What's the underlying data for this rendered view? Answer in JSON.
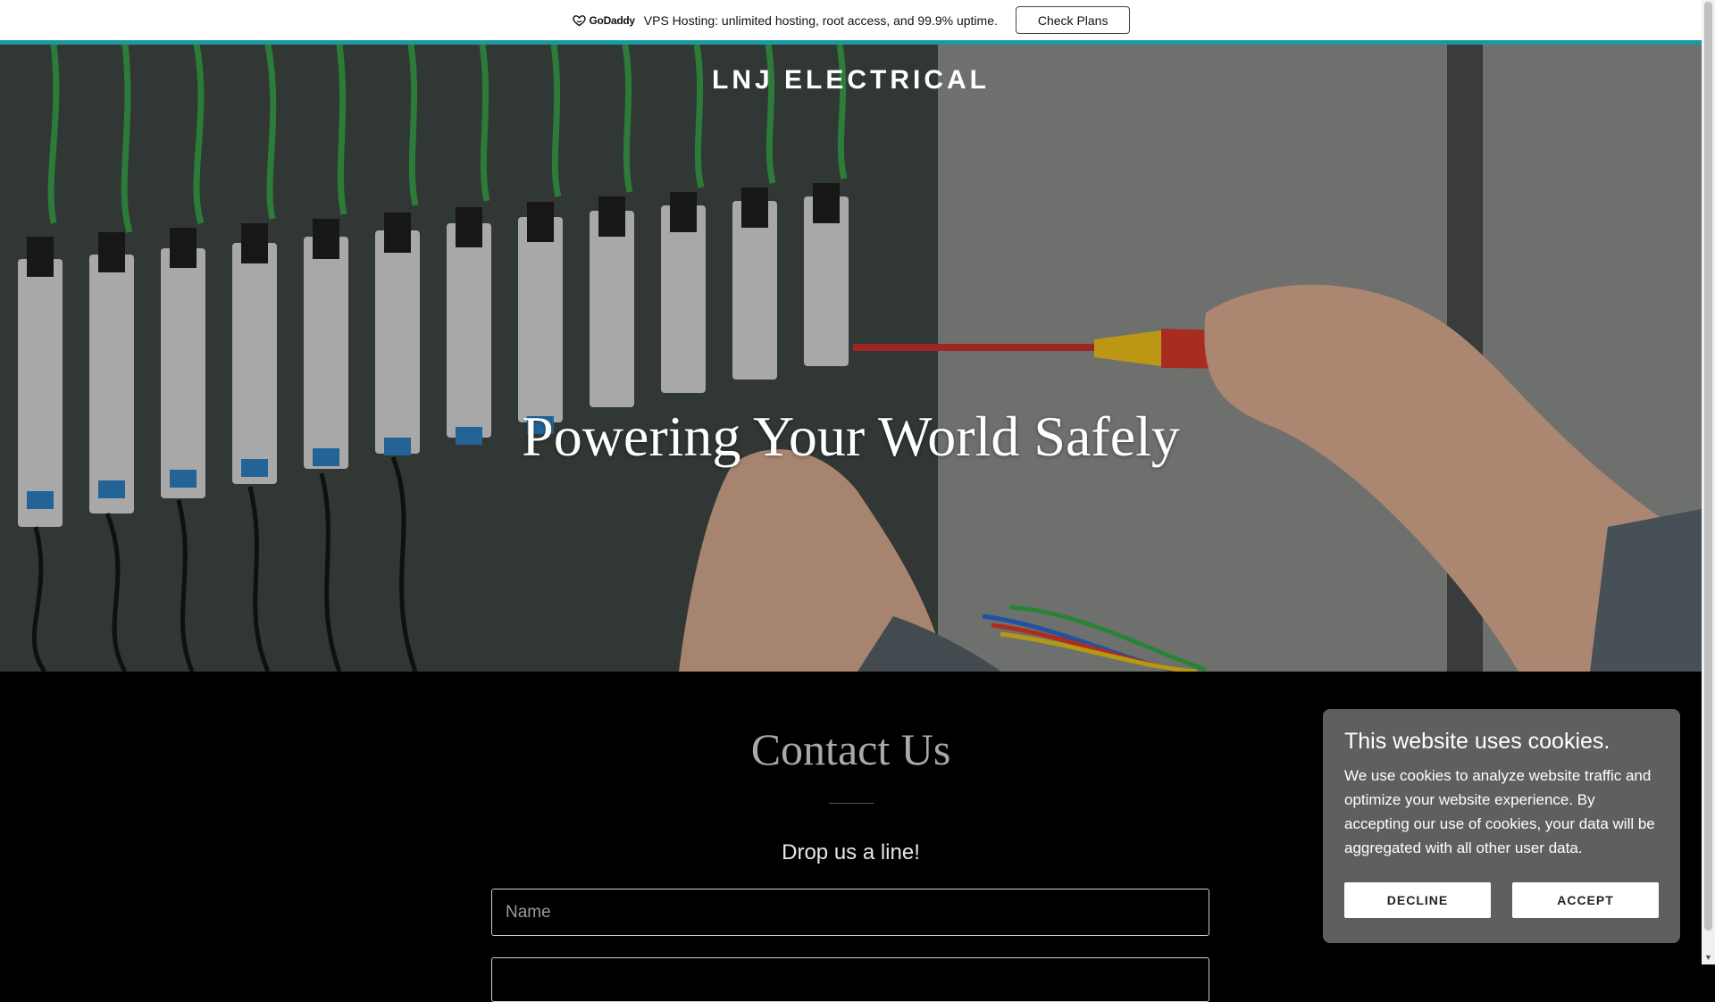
{
  "promo": {
    "logo_text": "GoDaddy",
    "message": "VPS Hosting: unlimited hosting, root access, and 99.9% uptime.",
    "button_label": "Check Plans",
    "accent_color": "#1a9aa0"
  },
  "hero": {
    "brand": "LNJ ELECTRICAL",
    "headline": "Powering Your World Safely"
  },
  "contact": {
    "title": "Contact Us",
    "subtitle": "Drop us a line!",
    "name_placeholder": "Name"
  },
  "cookie": {
    "title": "This website uses cookies.",
    "body": "We use cookies to analyze website traffic and optimize your website experience. By accepting our use of cookies, your data will be aggregated with all other user data.",
    "decline_label": "DECLINE",
    "accept_label": "ACCEPT"
  },
  "icons": [
    "godaddy-logo-icon",
    "scroll-down-arrow-icon"
  ]
}
